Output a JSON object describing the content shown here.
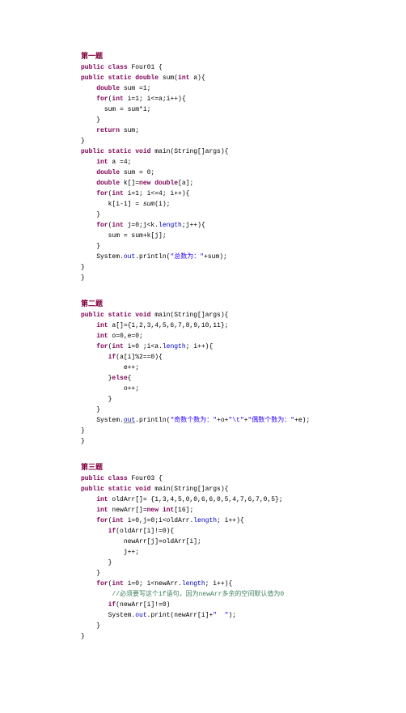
{
  "section1": {
    "title": "第一题",
    "t": {
      "l1_public": "public",
      "l1_class": "class",
      "l1_name": "Four01 {",
      "l2": "public static double",
      "l2b": "sum(",
      "l2_int": "int",
      "l2c": " a){",
      "l3a": "double",
      "l3b": " sum =1;",
      "l4a": "for",
      "l4b": "(",
      "l4c": "int",
      "l4d": " i=1; i<=a;i++){",
      "l5": "sum = sum*i;",
      "l6": "}",
      "l7a": "return",
      "l7b": " sum;",
      "l8": "}",
      "l9a": "public static void",
      "l9b": " main(String[]args){",
      "l10a": "int",
      "l10b": " a =4;",
      "l11a": "double",
      "l11b": " sum = 0;",
      "l12a": "double",
      "l12b": " k[]=",
      "l12c": "new double",
      "l12d": "[a];",
      "l13a": "for",
      "l13b": "(",
      "l13c": "int",
      "l13d": " i=1; i<=4; i++){",
      "l14": "k[i-1] = ",
      "l14a": "sum",
      "l14b": "(i);",
      "l15": "}",
      "l16a": "for",
      "l16b": "(",
      "l16c": "int",
      "l16d": " j=0;j<k.",
      "l16e": "length",
      "l16f": ";j++){",
      "l17": "sum = sum+k[j];",
      "l18": "}",
      "l19a": "System.",
      "l19b": "out",
      "l19c": ".println(",
      "l19d": "\"总数为：\"",
      "l19e": "+sum);",
      "l20": "}",
      "l21": "}"
    }
  },
  "section2": {
    "title": "第二题",
    "t": {
      "l1a": "public static void",
      "l1b": " main(String[]args){",
      "l2a": "int",
      "l2b": " a[]={1,2,3,4,5,6,7,8,9,10,11};",
      "l3a": "int",
      "l3b": " o=0,e=0;",
      "l4a": "for",
      "l4b": "(",
      "l4c": "int",
      "l4d": " i=0 ;i<a.",
      "l4e": "length",
      "l4f": "; i++){",
      "l5a": "if",
      "l5b": "(a[i]%2==0){",
      "l6": "e++;",
      "l7a": "}",
      "l7b": "else",
      "l7c": "{",
      "l8": "o++;",
      "l9": "}",
      "l10": "}",
      "l11a": "System.",
      "l11b": "out",
      "l11c": ".println(",
      "l11d": "\"奇数个数为：\"",
      "l11e": "+o+",
      "l11f": "\"\\t\"",
      "l11g": "+",
      "l11h": "\"偶数个数为：\"",
      "l11i": "+e);",
      "l12": "}",
      "l13": "}"
    }
  },
  "section3": {
    "title": "第三题",
    "t": {
      "l1a": "public",
      "l1b": " class",
      "l1c": " Four03 {",
      "l2a": "public static void",
      "l2b": " main(String[]args){",
      "l3a": "int",
      "l3b": " oldArr[]= {1,3,4,5,0,0,6,6,0,5,4,7,6,7,0,5};",
      "l4a": "int",
      "l4b": " newArr[]=",
      "l4c": "new int",
      "l4d": "[16];",
      "l5a": "for",
      "l5b": "(",
      "l5c": "int",
      "l5d": " i=0,j=0;i<oldArr.",
      "l5e": "length",
      "l5f": "; i++){",
      "l6a": "if",
      "l6b": "(oldArr[i]!=0){",
      "l7": "newArr[j]=oldArr[i];",
      "l8": "j++;",
      "l9": "}",
      "l10": "}",
      "l11a": "for",
      "l11b": "(",
      "l11c": "int",
      "l11d": " i=0; i<newArr.",
      "l11e": "length",
      "l11f": "; i++){",
      "l12": "//必须要写这个if语句，因为newArr多余的空间默认值为0",
      "l13a": "if",
      "l13b": "(newArr[i]!=0)",
      "l14a": "System.",
      "l14b": "out",
      "l14c": ".print(newArr[i]+",
      "l14d": "\"  \"",
      "l14e": ");",
      "l15": "}",
      "l16": "}"
    }
  }
}
